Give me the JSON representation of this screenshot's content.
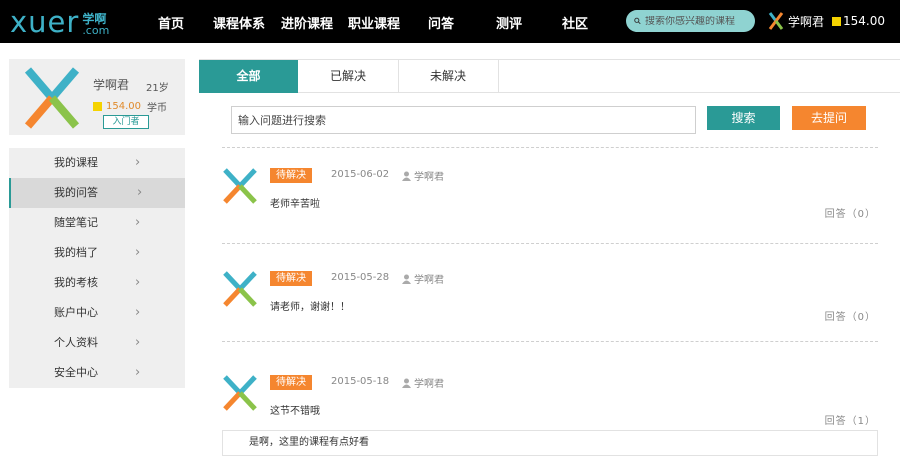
{
  "header": {
    "logo_text": "xuer",
    "logo_cn": "学啊",
    "logo_com": ".com",
    "nav": [
      "首页",
      "课程体系",
      "进阶课程",
      "职业课程",
      "问答",
      "测评",
      "社区"
    ],
    "search_placeholder": "搜索你感兴趣的课程",
    "username": "学啊君",
    "coins": "154.00"
  },
  "profile": {
    "name": "学啊君",
    "age": "21岁",
    "coins": "154.00",
    "coin_unit": "学币",
    "progress_button": "入门者"
  },
  "sidebar": {
    "items": [
      {
        "label": "我的课程"
      },
      {
        "label": "我的问答"
      },
      {
        "label": "随堂笔记"
      },
      {
        "label": "我的档了"
      },
      {
        "label": "我的考核"
      },
      {
        "label": "账户中心"
      },
      {
        "label": "个人资料"
      },
      {
        "label": "安全中心"
      }
    ]
  },
  "tabs": [
    "全部",
    "已解决",
    "未解决"
  ],
  "qsearch": {
    "placeholder": "输入问题进行搜索",
    "search_label": "搜索",
    "ask_label": "去提问"
  },
  "questions": [
    {
      "status": "待解决",
      "date": "2015-06-02",
      "author": "学啊君",
      "title": "老师辛苦啦",
      "answers": "回答（0）"
    },
    {
      "status": "待解决",
      "date": "2015-05-28",
      "author": "学啊君",
      "title": "请老师，谢谢！！",
      "answers": "回答（0）"
    },
    {
      "status": "待解决",
      "date": "2015-05-18",
      "author": "学啊君",
      "title": "这节不错哦",
      "answers": "回答（1）"
    }
  ],
  "reply": "是啊，这里的课程有点好看",
  "colors": {
    "accent": "#2a9a96",
    "orange": "#f5862f",
    "logo": "#3eb1c7"
  }
}
